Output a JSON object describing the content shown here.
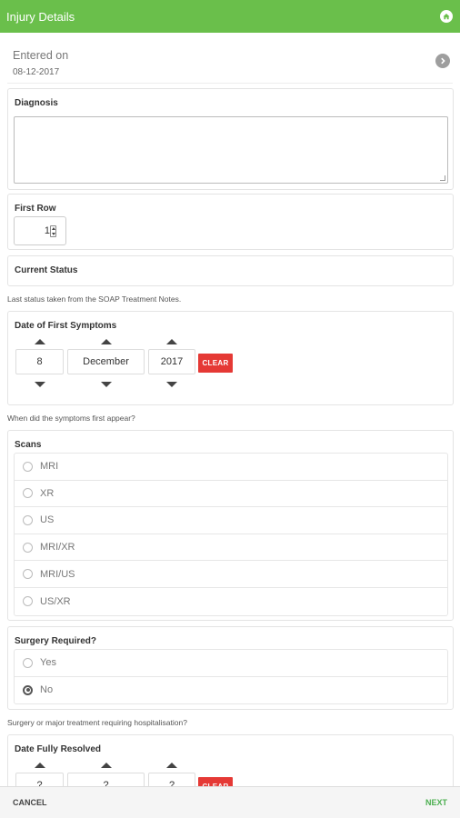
{
  "appbar": {
    "title": "Injury Details",
    "home_icon": "home-icon",
    "color": "#6abf4b"
  },
  "entered": {
    "label": "Entered on",
    "date": "08-12-2017",
    "chevron_icon": "chevron-right-circle-icon"
  },
  "diagnosis": {
    "title": "Diagnosis",
    "value": ""
  },
  "first_row": {
    "title": "First Row",
    "value": "1"
  },
  "current_status": {
    "title": "Current Status",
    "helper": "Last status taken from the SOAP Treatment Notes."
  },
  "first_symptoms": {
    "title": "Date of First Symptoms",
    "day": "8",
    "month": "December",
    "year": "2017",
    "clear_label": "CLEAR",
    "helper": "When did the symptoms first appear?"
  },
  "scans": {
    "title": "Scans",
    "options": [
      "MRI",
      "XR",
      "US",
      "MRI/XR",
      "MRI/US",
      "US/XR"
    ]
  },
  "surgery": {
    "title": "Surgery Required?",
    "options": [
      "Yes",
      "No"
    ],
    "selected": "No",
    "helper": "Surgery or major treatment requiring hospitalisation?"
  },
  "fully_resolved": {
    "title": "Date Fully Resolved",
    "day": "?",
    "month": "?",
    "year": "?"
  },
  "footer": {
    "cancel_label": "CANCEL",
    "next_label": "NEXT",
    "next_color": "#4caf50",
    "clear_color": "#e53935"
  }
}
